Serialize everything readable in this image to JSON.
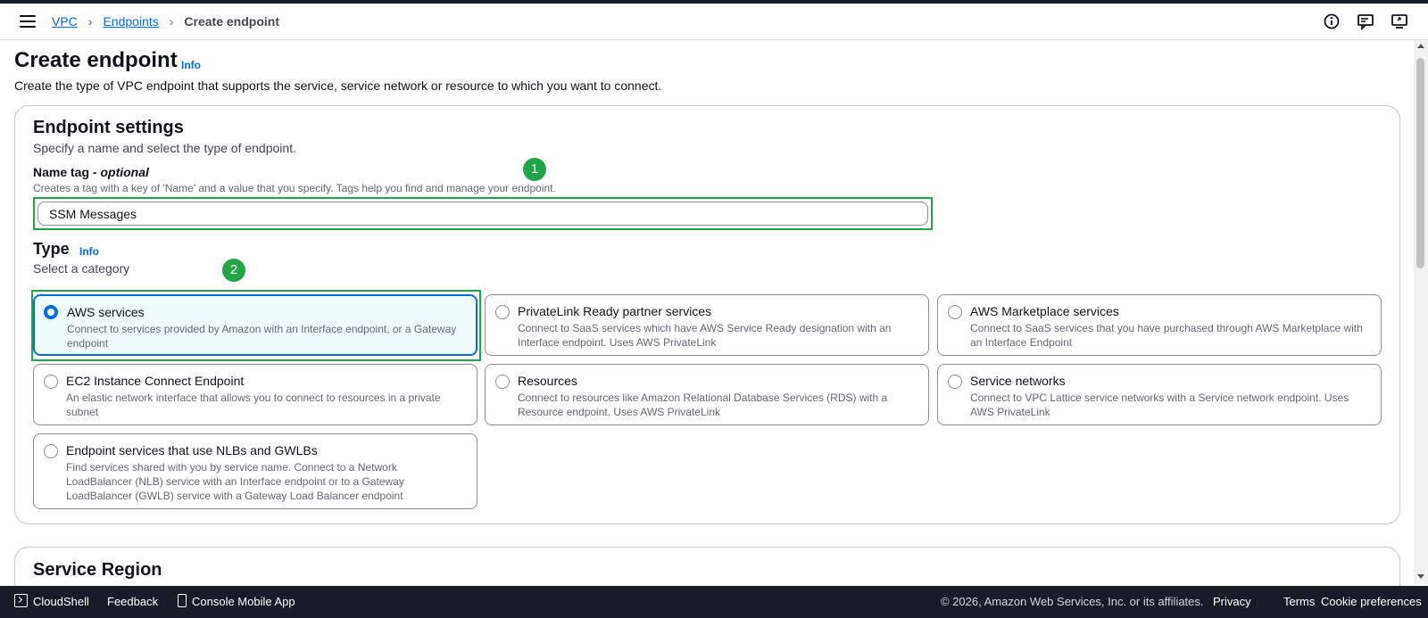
{
  "breadcrumb": {
    "vpc": "VPC",
    "endpoints": "Endpoints",
    "current": "Create endpoint"
  },
  "page": {
    "title": "Create endpoint",
    "info": "Info",
    "description": "Create the type of VPC endpoint that supports the service, service network or resource to which you want to connect."
  },
  "settings": {
    "heading": "Endpoint settings",
    "description": "Specify a name and select the type of endpoint.",
    "name_label": "Name tag - ",
    "name_optional": "optional",
    "name_hint": "Creates a tag with a key of 'Name' and a value that you specify. Tags help you find and manage your endpoint.",
    "name_value": "SSM Messages",
    "type_heading": "Type",
    "type_info": "Info",
    "type_desc": "Select a category",
    "tiles": [
      {
        "title": "AWS services",
        "desc": "Connect to services provided by Amazon with an Interface endpoint, or a Gateway endpoint",
        "selected": true
      },
      {
        "title": "PrivateLink Ready partner services",
        "desc": "Connect to SaaS services which have AWS Service Ready designation with an Interface endpoint. Uses AWS PrivateLink",
        "selected": false
      },
      {
        "title": "AWS Marketplace services",
        "desc": "Connect to SaaS services that you have purchased through AWS Marketplace with an Interface Endpoint",
        "selected": false
      },
      {
        "title": "EC2 Instance Connect Endpoint",
        "desc": "An elastic network interface that allows you to connect to resources in a private subnet",
        "selected": false
      },
      {
        "title": "Resources",
        "desc": "Connect to resources like Amazon Relational Database Services (RDS) with a Resource endpoint. Uses AWS PrivateLink",
        "selected": false
      },
      {
        "title": "Service networks",
        "desc": "Connect to VPC Lattice service networks with a Service network endpoint. Uses AWS PrivateLink",
        "selected": false
      },
      {
        "title": "Endpoint services that use NLBs and GWLBs",
        "desc": "Find services shared with you by service name. Connect to a Network LoadBalancer (NLB) service with an Interface endpoint or to a Gateway LoadBalancer (GWLB) service with a Gateway Load Balancer endpoint",
        "selected": false
      }
    ]
  },
  "annotations": {
    "step1": "1",
    "step2": "2"
  },
  "service_region": {
    "heading": "Service Region"
  },
  "footer": {
    "cloudshell": "CloudShell",
    "feedback": "Feedback",
    "mobile_app": "Console Mobile App",
    "copyright": "© 2026, Amazon Web Services, Inc. or its affiliates.",
    "privacy": "Privacy",
    "terms": "Terms",
    "cookies": "Cookie preferences"
  },
  "icons": [
    "menu-icon",
    "info-circle-icon",
    "feedback-icon",
    "display-icon",
    "cloudshell-icon",
    "mobile-icon"
  ],
  "colors": {
    "link": "#006ce0",
    "selected_bg": "#f0fbff",
    "annotation_green": "#22a447",
    "footer_bg": "#161d26"
  }
}
